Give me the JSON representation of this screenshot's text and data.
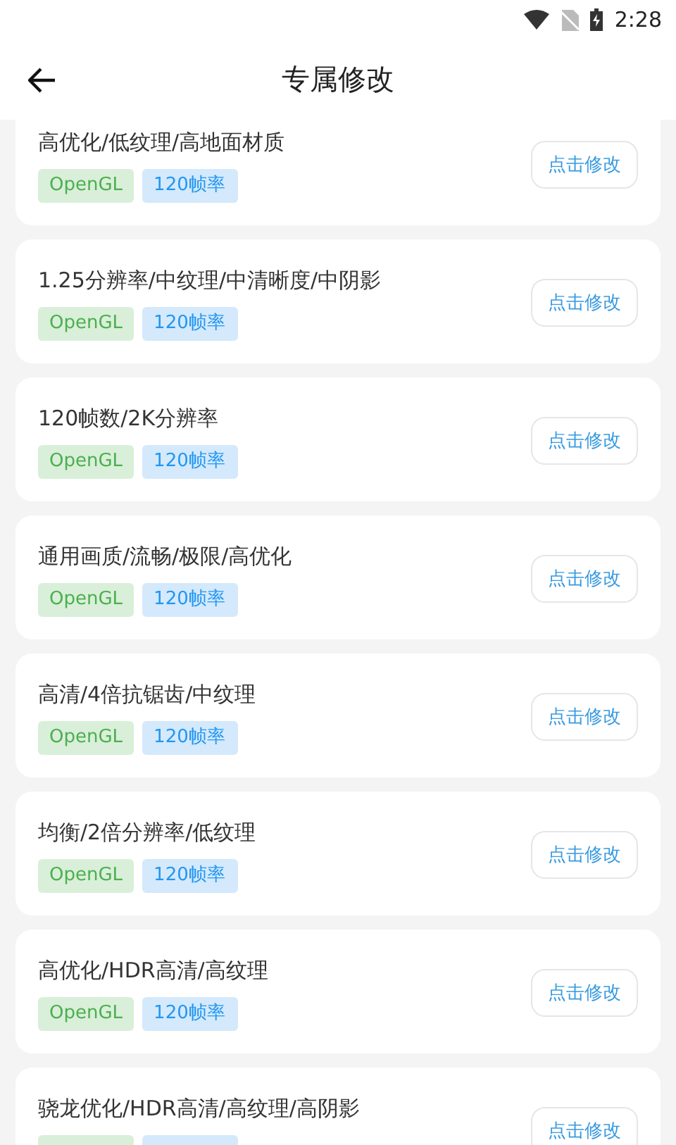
{
  "status_bar": {
    "time": "2:28"
  },
  "header": {
    "title": "专属修改"
  },
  "cards": [
    {
      "title": "高优化/低纹理/高地面材质",
      "tags": [
        {
          "label": "OpenGL",
          "kind": "api",
          "color": "#d9efd9"
        },
        {
          "label": "120帧率",
          "kind": "fps",
          "color": "#d4e9fb"
        }
      ],
      "button": "点击修改"
    },
    {
      "title": "1.25分辨率/中纹理/中清晰度/中阴影",
      "tags": [
        {
          "label": "OpenGL",
          "kind": "api",
          "color": "#d9efd9"
        },
        {
          "label": "120帧率",
          "kind": "fps",
          "color": "#d4e9fb"
        }
      ],
      "button": "点击修改"
    },
    {
      "title": "120帧数/2K分辨率",
      "tags": [
        {
          "label": "OpenGL",
          "kind": "api",
          "color": "#d9efd9"
        },
        {
          "label": "120帧率",
          "kind": "fps",
          "color": "#d4e9fb"
        }
      ],
      "button": "点击修改"
    },
    {
      "title": "通用画质/流畅/极限/高优化",
      "tags": [
        {
          "label": "OpenGL",
          "kind": "api",
          "color": "#d9efd9"
        },
        {
          "label": "120帧率",
          "kind": "fps",
          "color": "#d4e9fb"
        }
      ],
      "button": "点击修改"
    },
    {
      "title": "高清/4倍抗锯齿/中纹理",
      "tags": [
        {
          "label": "OpenGL",
          "kind": "api",
          "color": "#d9efd9"
        },
        {
          "label": "120帧率",
          "kind": "fps",
          "color": "#d4e9fb"
        }
      ],
      "button": "点击修改"
    },
    {
      "title": "均衡/2倍分辨率/低纹理",
      "tags": [
        {
          "label": "OpenGL",
          "kind": "api",
          "color": "#d9efd9"
        },
        {
          "label": "120帧率",
          "kind": "fps",
          "color": "#d4e9fb"
        }
      ],
      "button": "点击修改"
    },
    {
      "title": "高优化/HDR高清/高纹理",
      "tags": [
        {
          "label": "OpenGL",
          "kind": "api",
          "color": "#d9efd9"
        },
        {
          "label": "120帧率",
          "kind": "fps",
          "color": "#d4e9fb"
        }
      ],
      "button": "点击修改"
    },
    {
      "title": "骁龙优化/HDR高清/高纹理/高阴影",
      "tags": [
        {
          "kind": "api",
          "color": "#d9efd9"
        },
        {
          "kind": "fps",
          "color": "#d4e9fb"
        }
      ],
      "button": "点击修改"
    }
  ]
}
